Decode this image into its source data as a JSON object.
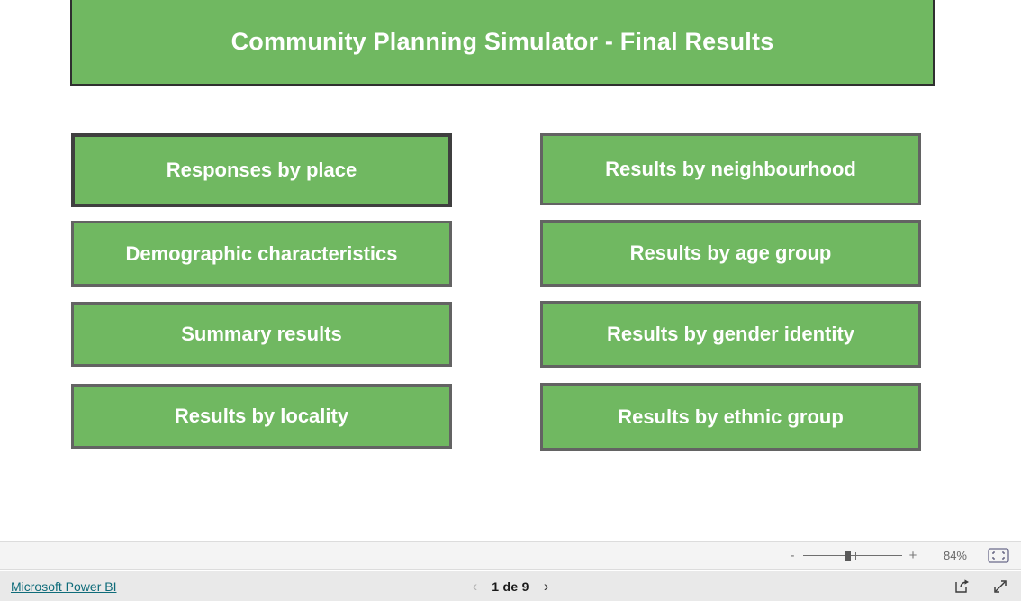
{
  "report": {
    "title": "Community Planning Simulator - Final Results",
    "theme": {
      "green": "#70b861",
      "border": "#636363",
      "border_selected": "#3f3f3f",
      "title_border": "#2f2f2f",
      "label_color": "#ffffff",
      "link_color": "#0f6c7a"
    },
    "buttons_left": [
      {
        "label": "Responses by place",
        "selected": true
      },
      {
        "label": "Demographic characteristics",
        "selected": false
      },
      {
        "label": "Summary results",
        "selected": false
      },
      {
        "label": "Results by locality",
        "selected": false
      }
    ],
    "buttons_right": [
      {
        "label": "Results by neighbourhood",
        "selected": false
      },
      {
        "label": "Results by age group",
        "selected": false
      },
      {
        "label": "Results by gender identity",
        "selected": false
      },
      {
        "label": "Results by ethnic group",
        "selected": false
      }
    ]
  },
  "zoom_toolbar": {
    "minus_label": "-",
    "plus_label": "+",
    "percent": "84%",
    "fit_icon": "fit-to-page-icon"
  },
  "footer": {
    "brand_link": "Microsoft Power BI",
    "prev_page_icon": "chevron-left-icon",
    "next_page_icon": "chevron-right-icon",
    "page_indicator": "1 de 9",
    "share_icon": "share-icon",
    "fullscreen_icon": "fullscreen-icon"
  }
}
